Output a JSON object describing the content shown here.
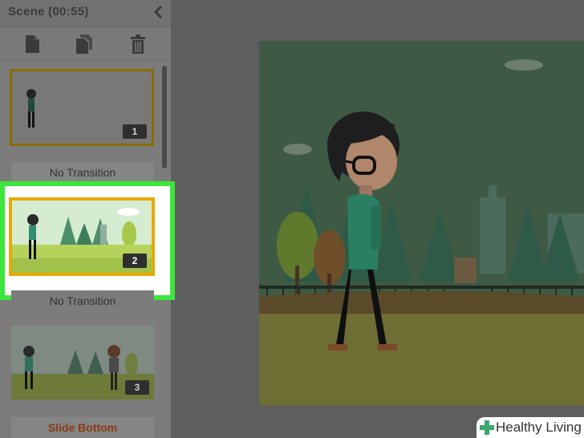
{
  "panel": {
    "title": "Scene",
    "duration": "(00:55)"
  },
  "toolbar": {
    "new_icon": "new-scene-icon",
    "duplicate_icon": "duplicate-scene-icon",
    "delete_icon": "delete-icon"
  },
  "scenes": [
    {
      "number": "1",
      "transition": "No Transition"
    },
    {
      "number": "2",
      "transition": "No Transition"
    },
    {
      "number": "3",
      "transition": "Slide Bottom"
    }
  ],
  "watermark": {
    "text": "Healthy Living"
  },
  "colors": {
    "highlight": "#3ce63c",
    "selected_border": "#e8a900",
    "scene1_border": "#8a6d00",
    "transition_3": "#8a3b12"
  }
}
